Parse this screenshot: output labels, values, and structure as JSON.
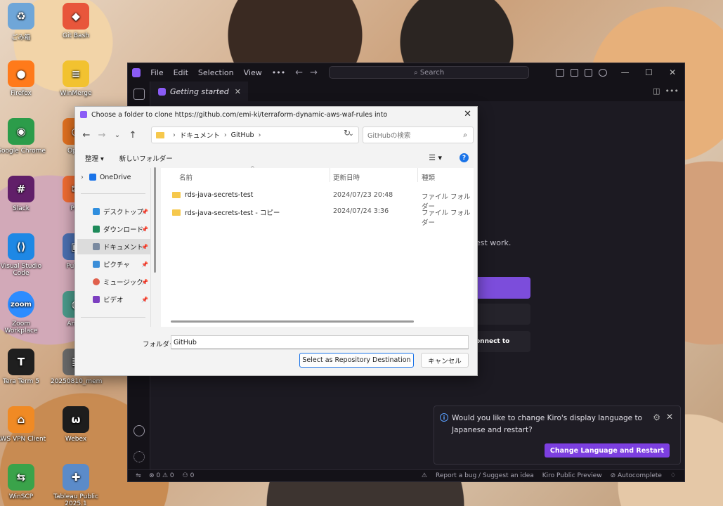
{
  "desktop": {
    "icons": [
      {
        "label": "ごみ箱",
        "color": "#6fa6d8",
        "glyph": "♻"
      },
      {
        "label": "Git Bash",
        "color": "#e8563b",
        "glyph": "◆"
      },
      {
        "label": "Firefox",
        "color": "#ff7a1a",
        "glyph": "●"
      },
      {
        "label": "WinMerge",
        "color": "#f2c230",
        "glyph": "≡"
      },
      {
        "label": "Google Chrome",
        "color": "#2c9c4a",
        "glyph": "◉"
      },
      {
        "label": "Open",
        "color": "#e07020",
        "glyph": "○"
      },
      {
        "label": "Slack",
        "color": "#611f69",
        "glyph": "#"
      },
      {
        "label": "Pos",
        "color": "#ef6c33",
        "glyph": "✉"
      },
      {
        "label": "Visual Studio Code",
        "color": "#1e88e5",
        "glyph": "⟨⟩"
      },
      {
        "label": "PuTTY",
        "color": "#4a6fb0",
        "glyph": "▣"
      },
      {
        "label": "Zoom Workplace",
        "color": "#2d8cff",
        "glyph": "zoom"
      },
      {
        "label": "Amaz",
        "color": "#4a9a8a",
        "glyph": "◍"
      },
      {
        "label": "Tera Term 5",
        "color": "#1f1f1f",
        "glyph": "T"
      },
      {
        "label": "20250810_mem",
        "color": "#6a6a6a",
        "glyph": "≣"
      },
      {
        "label": "AWS VPN Client",
        "color": "#f08a24",
        "glyph": "⌂"
      },
      {
        "label": "Webex",
        "color": "#1d1d1d",
        "glyph": "ω"
      },
      {
        "label": "WinSCP",
        "color": "#3aa34a",
        "glyph": "⇆"
      },
      {
        "label": "Tableau Public 2025.1",
        "color": "#5b8bc9",
        "glyph": "✚"
      }
    ]
  },
  "kiro": {
    "menu": [
      "File",
      "Edit",
      "Selection",
      "View",
      "•••"
    ],
    "search_placeholder": "Search",
    "tab_label": "Getting started",
    "bg_text": "est work.",
    "bg_connect": "onnect to",
    "notification": {
      "text": "Would you like to change Kiro's display language to Japanese and restart?",
      "button": "Change Language and Restart"
    },
    "status": {
      "problems": "⊗ 0 ⚠ 0",
      "ports": "⚇ 0",
      "report": "Report a bug / Suggest an idea",
      "preview": "Kiro Public Preview",
      "autocomplete": "Autocomplete"
    }
  },
  "dialog": {
    "title": "Choose a folder to clone https://github.com/emi-ki/terraform-dynamic-aws-waf-rules into",
    "address": {
      "segments": [
        "ドキュメント",
        "GitHub"
      ]
    },
    "search_placeholder": "GitHubの検索",
    "toolbar": {
      "organize": "整理 ▾",
      "new_folder": "新しいフォルダー"
    },
    "sidebar": [
      {
        "label": "OneDrive",
        "color": "#1a73e8"
      },
      {
        "label": "デスクトップ",
        "color": "#2f8ede"
      },
      {
        "label": "ダウンロード",
        "color": "#1e8a5a"
      },
      {
        "label": "ドキュメント",
        "color": "#7a8aa0"
      },
      {
        "label": "ピクチャ",
        "color": "#3b8ed8"
      },
      {
        "label": "ミュージック",
        "color": "#e0604c"
      },
      {
        "label": "ビデオ",
        "color": "#7c3fc0"
      }
    ],
    "columns": {
      "name": "名前",
      "date": "更新日時",
      "type": "種類"
    },
    "rows": [
      {
        "name": "rds-java-secrets-test",
        "date": "2024/07/23 20:48",
        "type": "ファイル フォルダー"
      },
      {
        "name": "rds-java-secrets-test - コピー",
        "date": "2024/07/24 3:36",
        "type": "ファイル フォルダー"
      }
    ],
    "folder_label": "フォルダー:",
    "folder_value": "GitHub",
    "primary_button": "Select as Repository Destination",
    "cancel_button": "キャンセル"
  }
}
